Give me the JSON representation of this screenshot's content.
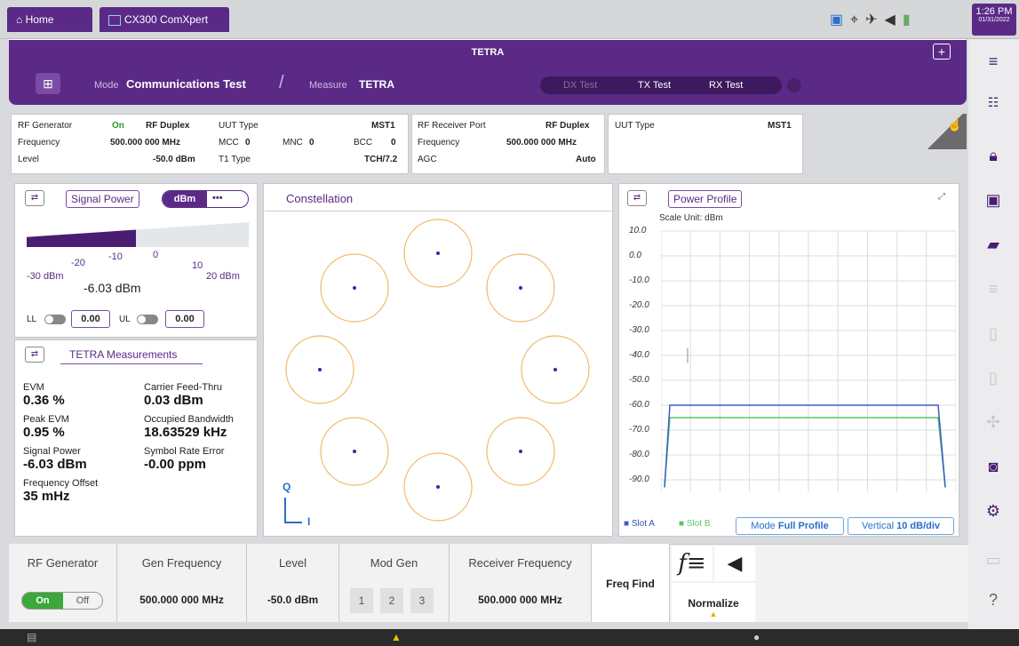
{
  "top": {
    "home": "Home",
    "app_tab": "CX300 ComXpert",
    "time": "1:26 PM",
    "date": "01/31/2022"
  },
  "title": "TETRA",
  "mode": {
    "mode_label": "Mode",
    "mode_value": "Communications Test",
    "measure_label": "Measure",
    "measure_value": "TETRA",
    "tabs": [
      "DX Test",
      "TX Test",
      "RX Test"
    ]
  },
  "info": {
    "rf_gen_label": "RF Generator",
    "rf_gen_state": "On",
    "rf_gen_mode": "RF Duplex",
    "freq_label": "Frequency",
    "freq_value": "500.000 000 MHz",
    "level_label": "Level",
    "level_value": "-50.0 dBm",
    "uut_type_label": "UUT Type",
    "uut_type_value": "MST1",
    "mcc_label": "MCC",
    "mcc_value": "0",
    "mnc_label": "MNC",
    "mnc_value": "0",
    "bcc_label": "BCC",
    "bcc_value": "0",
    "t1_type_label": "T1 Type",
    "t1_type_value": "TCH/7.2",
    "rx_port_label": "RF Receiver Port",
    "rx_port_value": "RF Duplex",
    "rx_freq_label": "Frequency",
    "rx_freq_value": "500.000 000 MHz",
    "agc_label": "AGC",
    "agc_value": "Auto",
    "uut_type2_label": "UUT Type",
    "uut_type2_value": "MST1"
  },
  "signal_power": {
    "title": "Signal Power",
    "unit_toggle": "dBm",
    "more": "•••",
    "scale": [
      "-30 dBm",
      "-20",
      "-10",
      "0",
      "10",
      "20 dBm"
    ],
    "value": "-6.03 dBm",
    "ll_label": "LL",
    "ll_value": "0.00",
    "ul_label": "UL",
    "ul_value": "0.00",
    "gauge_fraction": 0.49
  },
  "tetra_meas": {
    "title": "TETRA Measurements",
    "items": [
      {
        "label": "EVM",
        "value": "0.36 %"
      },
      {
        "label": "Peak EVM",
        "value": "0.95 %"
      },
      {
        "label": "Signal Power",
        "value": "-6.03 dBm"
      },
      {
        "label": "Frequency Offset",
        "value": "35 mHz"
      },
      {
        "label": "Carrier Feed-Thru",
        "value": "0.03 dBm"
      },
      {
        "label": "Occupied Bandwidth",
        "value": "18.63529 kHz"
      },
      {
        "label": "Symbol Rate Error",
        "value": "-0.00 ppm"
      }
    ]
  },
  "constellation": {
    "title": "Constellation",
    "q": "Q",
    "i": "I"
  },
  "power_profile": {
    "title": "Power Profile",
    "scale_unit": "Scale Unit: dBm",
    "yticks": [
      "10.0",
      "0.0",
      "-10.0",
      "-20.0",
      "-30.0",
      "-40.0",
      "-50.0",
      "-60.0",
      "-70.0",
      "-80.0",
      "-90.0"
    ],
    "slot_a": "Slot A",
    "slot_b": "Slot B",
    "mode_label": "Mode",
    "mode_value": "Full Profile",
    "vert_label": "Vertical",
    "vert_value": "10 dB/div",
    "colors": {
      "slot_a": "#3a5ec8",
      "slot_b": "#5ac466"
    }
  },
  "chart_data": {
    "type": "line",
    "title": "Power Profile",
    "ylabel": "Scale Unit: dBm",
    "ylim": [
      -95,
      10
    ],
    "series": [
      {
        "name": "Slot A",
        "values": [
          -93,
          -60,
          -60,
          -60,
          -60,
          -93
        ]
      },
      {
        "name": "Slot B",
        "values": [
          -93,
          -65,
          -65,
          -65,
          -65,
          -93
        ]
      }
    ]
  },
  "bottom": {
    "rf_gen": "RF Generator",
    "on": "On",
    "off": "Off",
    "gen_freq": "Gen Frequency",
    "gen_freq_value": "500.000 000 MHz",
    "level": "Level",
    "level_value": "-50.0 dBm",
    "mod_gen": "Mod Gen",
    "mod_buttons": [
      "1",
      "2",
      "3"
    ],
    "rx_freq": "Receiver Frequency",
    "rx_freq_value": "500.000 000 MHz",
    "freq_find": "Freq Find",
    "normalize": "Normalize"
  }
}
